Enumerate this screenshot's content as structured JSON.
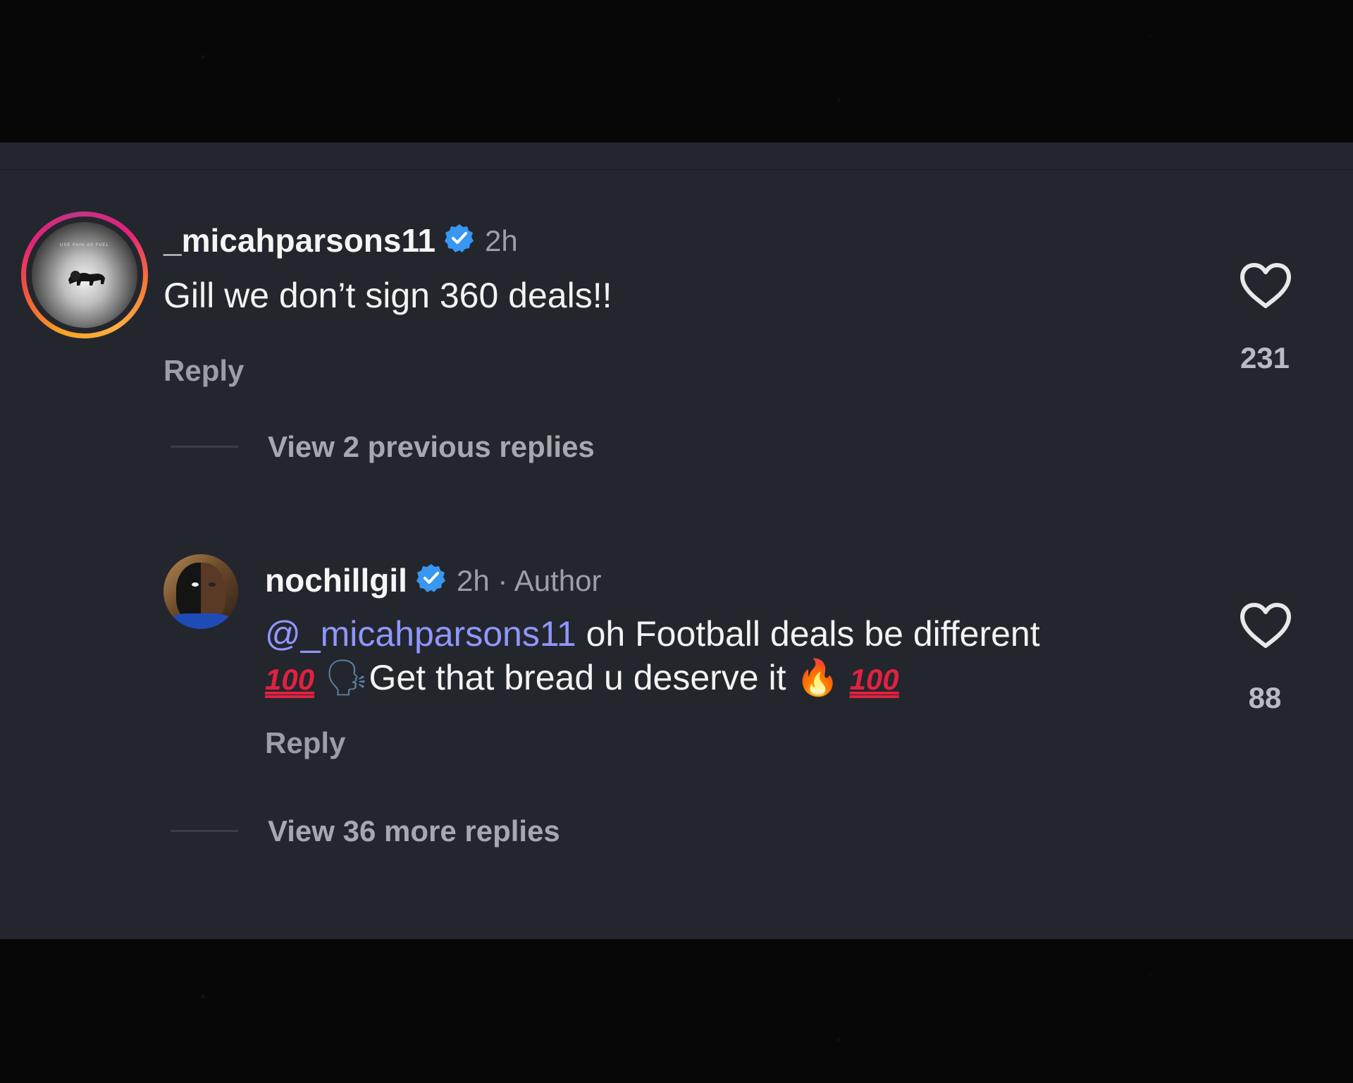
{
  "comments": [
    {
      "username": "_micahparsons11",
      "time": "2h",
      "text": "Gill we don’t sign 360 deals!!",
      "reply_label": "Reply",
      "likes": "231",
      "view_replies": "View 2 previous replies",
      "avatar_caption": "USE PAIN AS FUEL"
    },
    {
      "username": "nochillgil",
      "time": "2h · Author",
      "mention": "@_micahparsons11",
      "text_line1": " oh Football deals be different",
      "text_line2": "Get that bread u deserve it",
      "emoji_100": "100",
      "emoji_speaking": "🗣",
      "emoji_fire": "🔥",
      "reply_label": "Reply",
      "likes": "88",
      "view_replies": "View 36 more replies"
    }
  ],
  "icons": [
    "verified-badge-icon",
    "heart-icon"
  ],
  "colors": {
    "panel_bg": "#24262e",
    "verified": "#3897f0",
    "mention": "#8f97ff"
  }
}
